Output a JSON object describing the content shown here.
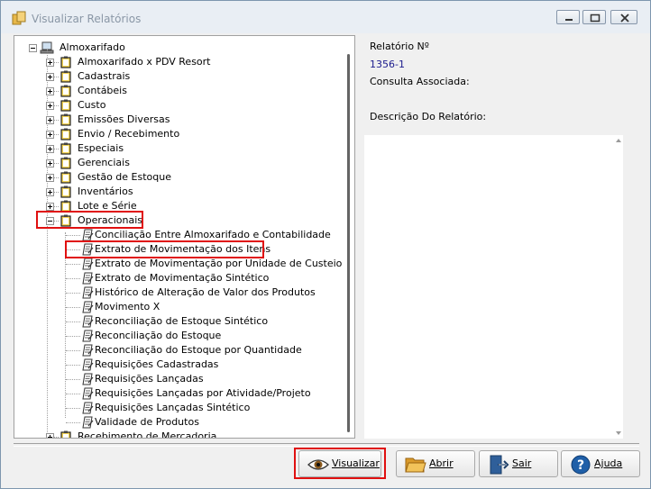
{
  "window": {
    "title": "Visualizar Relatórios"
  },
  "tree": {
    "root": "Almoxarifado",
    "categories": [
      "Almoxarifado x PDV Resort",
      "Cadastrais",
      "Contábeis",
      "Custo",
      "Emissões Diversas",
      "Envio / Recebimento",
      "Especiais",
      "Gerenciais",
      "Gestão de Estoque",
      "Inventários",
      "Lote e Série",
      "Operacionais"
    ],
    "expanded_category": "Operacionais",
    "reports": [
      "Conciliação Entre Almoxarifado e Contabilidade",
      "Extrato de Movimentação dos Itens",
      "Extrato de Movimentação por Unidade de Custeio",
      "Extrato de Movimentação Sintético",
      "Histórico de Alteração de Valor dos Produtos",
      "Movimento X",
      "Reconciliação de Estoque Sintético",
      "Reconciliação do Estoque",
      "Reconciliação do Estoque por Quantidade",
      "Requisições Cadastradas",
      "Requisições Lançadas",
      "Requisições Lançadas por Atividade/Projeto",
      "Requisições Lançadas Sintético",
      "Validade de Produtos"
    ],
    "selected_report": "Extrato de Movimentação dos Itens",
    "last_category": "Recebimento de Mercadoria"
  },
  "info": {
    "report_no_label": "Relatório Nº",
    "report_no_value": "1356-1",
    "query_label": "Consulta Associada:",
    "description_label": "Descrição Do Relatório:"
  },
  "buttons": {
    "visualizar": "Visualizar",
    "abrir": "Abrir",
    "sair": "Sair",
    "ajuda": "Ajuda"
  },
  "colors": {
    "highlight": "#e01010",
    "tree_lines": "#a0a0a0",
    "value_text": "#1a1a8c"
  }
}
